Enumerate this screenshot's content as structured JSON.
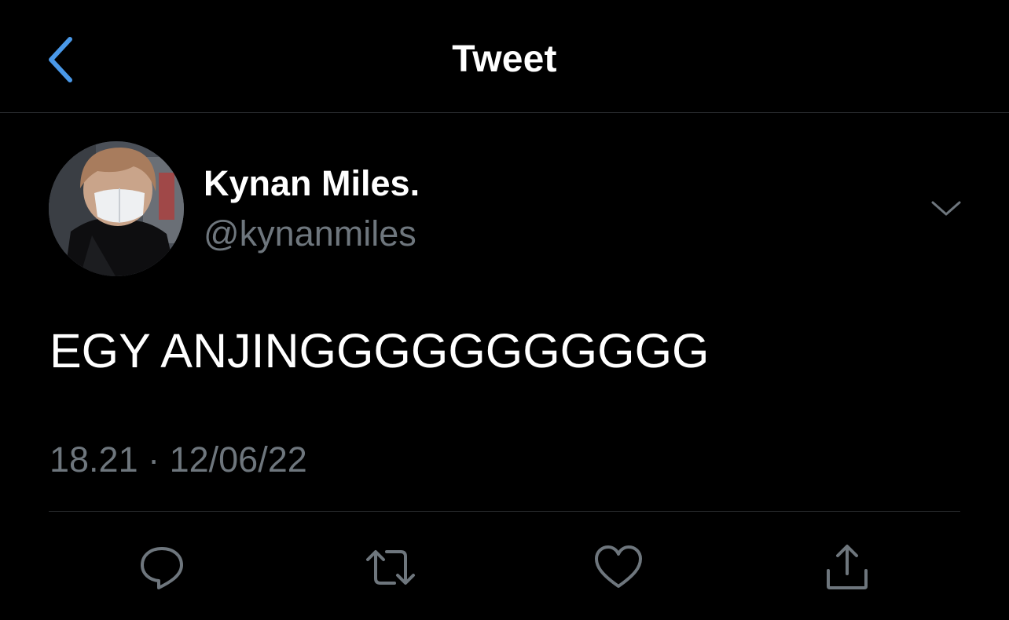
{
  "header": {
    "title": "Tweet",
    "back_icon": "chevron-left-icon",
    "accent_color": "#4a99e9"
  },
  "tweet": {
    "author_name": "Kynan Miles.",
    "author_handle": "@kynanmiles",
    "text": "EGY ANJINGGGGGGGGGGG",
    "timestamp": "18.21 · 12/06/22",
    "more_icon": "chevron-down-icon"
  },
  "actions": [
    {
      "icon": "reply-icon"
    },
    {
      "icon": "retweet-icon"
    },
    {
      "icon": "like-icon"
    },
    {
      "icon": "share-icon"
    }
  ],
  "colors": {
    "background": "#000000",
    "text_primary": "#ffffff",
    "text_secondary": "#6e767d",
    "divider": "#2a2d30"
  }
}
